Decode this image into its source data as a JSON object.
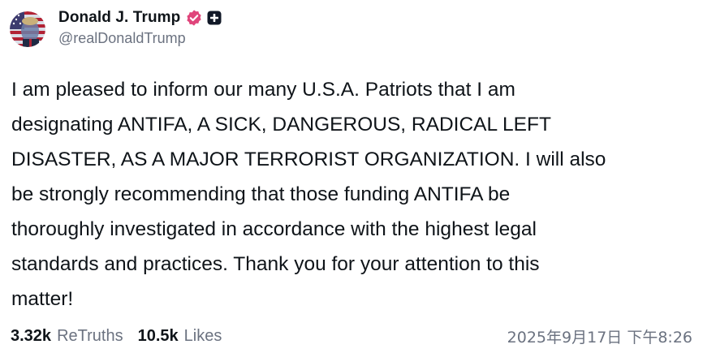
{
  "author": {
    "display_name": "Donald J. Trump",
    "handle": "@realDonaldTrump",
    "verified_icon": "verified-badge-icon",
    "plus_icon": "plus-square-icon",
    "verified_color": "#e0457b"
  },
  "post": {
    "lines": [
      "I am pleased to inform our many U.S.A. Patriots that I am",
      "designating ANTIFA, A SICK, DANGEROUS, RADICAL LEFT",
      "DISASTER, AS A MAJOR TERRORIST ORGANIZATION. I will also",
      "be strongly recommending that those funding ANTIFA be",
      "thoroughly investigated in accordance with the highest legal",
      "standards and practices. Thank you for your attention to this",
      "matter!"
    ]
  },
  "stats": {
    "retruths_count": "3.32k",
    "retruths_label": "ReTruths",
    "likes_count": "10.5k",
    "likes_label": "Likes"
  },
  "timestamp": "2025年9月17日 下午8:26"
}
